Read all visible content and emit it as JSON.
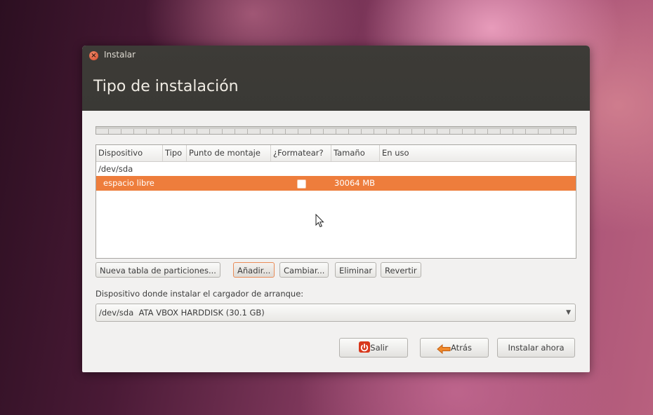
{
  "window": {
    "title": "Instalar",
    "page_title": "Tipo de instalación"
  },
  "table": {
    "headers": [
      "Dispositivo",
      "Tipo",
      "Punto de montaje",
      "¿Formatear?",
      "Tamaño",
      "En uso"
    ],
    "device_row": {
      "device": "/dev/sda"
    },
    "selected_row": {
      "device": "espacio libre",
      "format_checked": false,
      "size": "30064 MB"
    }
  },
  "partition_buttons": {
    "new_table": "Nueva tabla de particiones...",
    "add": "Añadir...",
    "change": "Cambiar...",
    "delete": "Eliminar",
    "revert": "Revertir"
  },
  "bootloader": {
    "label": "Dispositivo donde instalar el cargador de arranque:",
    "selected": "/dev/sda  ATA VBOX HARDDISK (30.1 GB)"
  },
  "footer_buttons": {
    "quit": "Salir",
    "back": "Atrás",
    "install": "Instalar ahora"
  },
  "icons": {
    "close": "close-icon",
    "quit": "power-icon",
    "back": "arrow-left-icon",
    "combo": "chevron-down-icon"
  },
  "colors": {
    "selection": "#ee7d3c",
    "titlebar": "#3c3b37"
  }
}
